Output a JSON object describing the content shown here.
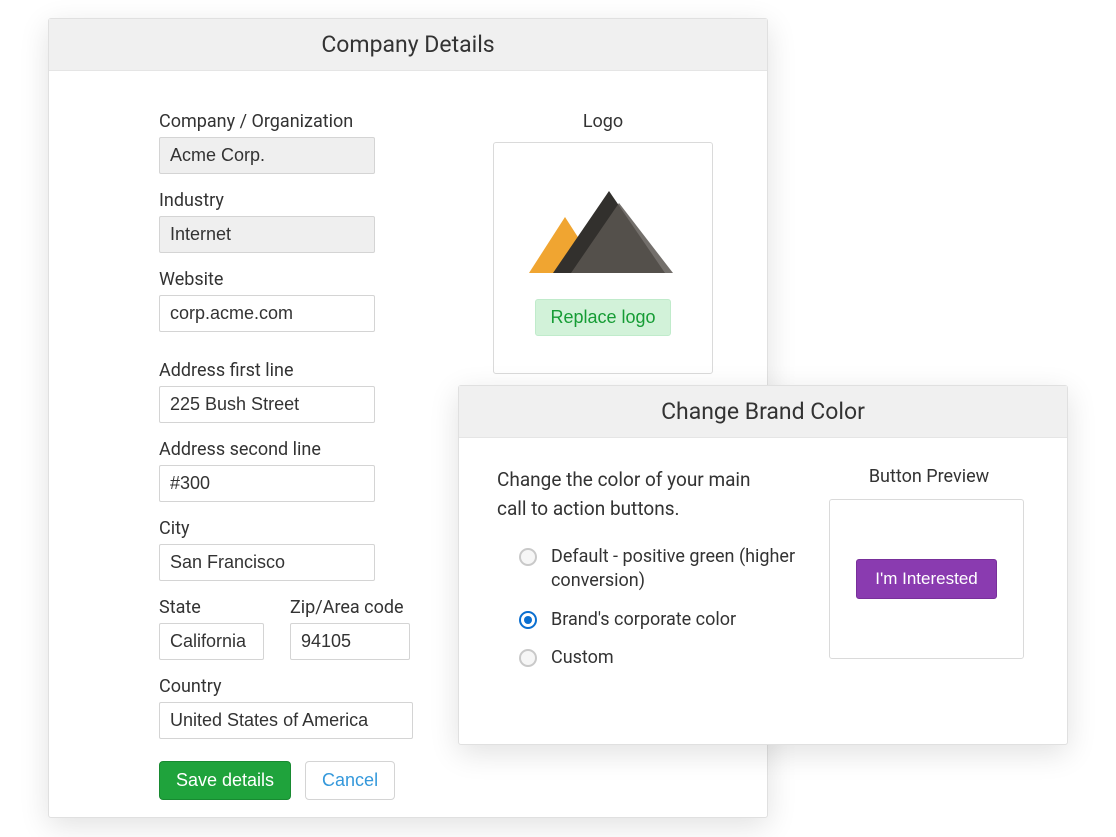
{
  "company_panel": {
    "title": "Company Details",
    "labels": {
      "company": "Company / Organization",
      "industry": "Industry",
      "website": "Website",
      "address1": "Address first line",
      "address2": "Address second line",
      "city": "City",
      "state": "State",
      "zip": "Zip/Area code",
      "country": "Country"
    },
    "values": {
      "company": "Acme Corp.",
      "industry": "Internet",
      "website": "corp.acme.com",
      "address1": "225 Bush Street",
      "address2": "#300",
      "city": "San Francisco",
      "state": "California",
      "zip": "94105",
      "country": "United States of America"
    },
    "buttons": {
      "save": "Save details",
      "cancel": "Cancel"
    },
    "logo": {
      "title": "Logo",
      "replace_label": "Replace logo"
    }
  },
  "brand_panel": {
    "title": "Change Brand Color",
    "description": "Change the color of your main call to action buttons.",
    "options": {
      "default": "Default - positive green (higher conversion)",
      "brand": "Brand's corporate color",
      "custom": "Custom"
    },
    "selected_option": "brand",
    "preview": {
      "title": "Button Preview",
      "button_label": "I'm Interested",
      "button_color": "#8a3bb0"
    }
  }
}
